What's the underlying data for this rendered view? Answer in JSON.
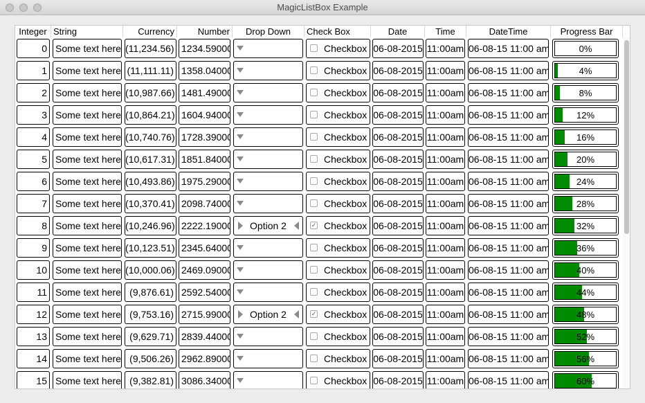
{
  "window": {
    "title": "MagicListBox Example"
  },
  "headers": [
    "Integer",
    "String",
    "Currency",
    "Number",
    "Drop Down",
    "Check Box",
    "Date",
    "Time",
    "DateTime",
    "Progress Bar"
  ],
  "rows": [
    {
      "integer": "0",
      "string": "Some text here.",
      "currency": "(11,234.56)",
      "number": "1234.59000",
      "dropdown": "",
      "checked": false,
      "checkbox": "Checkbox",
      "date": "06-08-2015",
      "time": "11:00am",
      "datetime": "06-08-15 11:00 am",
      "progress": 0,
      "progress_label": "0%"
    },
    {
      "integer": "1",
      "string": "Some text here.",
      "currency": "(11,111.11)",
      "number": "1358.04000",
      "dropdown": "",
      "checked": false,
      "checkbox": "Checkbox",
      "date": "06-08-2015",
      "time": "11:00am",
      "datetime": "06-08-15 11:00 am",
      "progress": 4,
      "progress_label": "4%"
    },
    {
      "integer": "2",
      "string": "Some text here.",
      "currency": "(10,987.66)",
      "number": "1481.49000",
      "dropdown": "",
      "checked": false,
      "checkbox": "Checkbox",
      "date": "06-08-2015",
      "time": "11:00am",
      "datetime": "06-08-15 11:00 am",
      "progress": 8,
      "progress_label": "8%"
    },
    {
      "integer": "3",
      "string": "Some text here.",
      "currency": "(10,864.21)",
      "number": "1604.94000",
      "dropdown": "",
      "checked": false,
      "checkbox": "Checkbox",
      "date": "06-08-2015",
      "time": "11:00am",
      "datetime": "06-08-15 11:00 am",
      "progress": 12,
      "progress_label": "12%"
    },
    {
      "integer": "4",
      "string": "Some text here.",
      "currency": "(10,740.76)",
      "number": "1728.39000",
      "dropdown": "",
      "checked": false,
      "checkbox": "Checkbox",
      "date": "06-08-2015",
      "time": "11:00am",
      "datetime": "06-08-15 11:00 am",
      "progress": 16,
      "progress_label": "16%"
    },
    {
      "integer": "5",
      "string": "Some text here.",
      "currency": "(10,617.31)",
      "number": "1851.84000",
      "dropdown": "",
      "checked": false,
      "checkbox": "Checkbox",
      "date": "06-08-2015",
      "time": "11:00am",
      "datetime": "06-08-15 11:00 am",
      "progress": 20,
      "progress_label": "20%"
    },
    {
      "integer": "6",
      "string": "Some text here.",
      "currency": "(10,493.86)",
      "number": "1975.29000",
      "dropdown": "",
      "checked": false,
      "checkbox": "Checkbox",
      "date": "06-08-2015",
      "time": "11:00am",
      "datetime": "06-08-15 11:00 am",
      "progress": 24,
      "progress_label": "24%"
    },
    {
      "integer": "7",
      "string": "Some text here.",
      "currency": "(10,370.41)",
      "number": "2098.74000",
      "dropdown": "",
      "checked": false,
      "checkbox": "Checkbox",
      "date": "06-08-2015",
      "time": "11:00am",
      "datetime": "06-08-15 11:00 am",
      "progress": 28,
      "progress_label": "28%"
    },
    {
      "integer": "8",
      "string": "Some text here.",
      "currency": "(10,246.96)",
      "number": "2222.19000",
      "dropdown": "Option 2",
      "checked": true,
      "checkbox": "Checkbox",
      "date": "06-08-2015",
      "time": "11:00am",
      "datetime": "06-08-15 11:00 am",
      "progress": 32,
      "progress_label": "32%"
    },
    {
      "integer": "9",
      "string": "Some text here.",
      "currency": "(10,123.51)",
      "number": "2345.64000",
      "dropdown": "",
      "checked": false,
      "checkbox": "Checkbox",
      "date": "06-08-2015",
      "time": "11:00am",
      "datetime": "06-08-15 11:00 am",
      "progress": 36,
      "progress_label": "36%"
    },
    {
      "integer": "10",
      "string": "Some text here.",
      "currency": "(10,000.06)",
      "number": "2469.09000",
      "dropdown": "",
      "checked": false,
      "checkbox": "Checkbox",
      "date": "06-08-2015",
      "time": "11:00am",
      "datetime": "06-08-15 11:00 am",
      "progress": 40,
      "progress_label": "40%"
    },
    {
      "integer": "11",
      "string": "Some text here.",
      "currency": "(9,876.61)",
      "number": "2592.54000",
      "dropdown": "",
      "checked": false,
      "checkbox": "Checkbox",
      "date": "06-08-2015",
      "time": "11:00am",
      "datetime": "06-08-15 11:00 am",
      "progress": 44,
      "progress_label": "44%"
    },
    {
      "integer": "12",
      "string": "Some text here.",
      "currency": "(9,753.16)",
      "number": "2715.99000",
      "dropdown": "Option 2",
      "checked": true,
      "checkbox": "Checkbox",
      "date": "06-08-2015",
      "time": "11:00am",
      "datetime": "06-08-15 11:00 am",
      "progress": 48,
      "progress_label": "48%"
    },
    {
      "integer": "13",
      "string": "Some text here.",
      "currency": "(9,629.71)",
      "number": "2839.44000",
      "dropdown": "",
      "checked": false,
      "checkbox": "Checkbox",
      "date": "06-08-2015",
      "time": "11:00am",
      "datetime": "06-08-15 11:00 am",
      "progress": 52,
      "progress_label": "52%"
    },
    {
      "integer": "14",
      "string": "Some text here.",
      "currency": "(9,506.26)",
      "number": "2962.89000",
      "dropdown": "",
      "checked": false,
      "checkbox": "Checkbox",
      "date": "06-08-2015",
      "time": "11:00am",
      "datetime": "06-08-15 11:00 am",
      "progress": 56,
      "progress_label": "56%"
    },
    {
      "integer": "15",
      "string": "Some text here.",
      "currency": "(9,382.81)",
      "number": "3086.34000",
      "dropdown": "",
      "checked": false,
      "checkbox": "Checkbox",
      "date": "06-08-2015",
      "time": "11:00am",
      "datetime": "06-08-15 11:00 am",
      "progress": 60,
      "progress_label": "60%"
    }
  ],
  "colors": {
    "progress_fill": "#008b00",
    "border": "#000000"
  }
}
